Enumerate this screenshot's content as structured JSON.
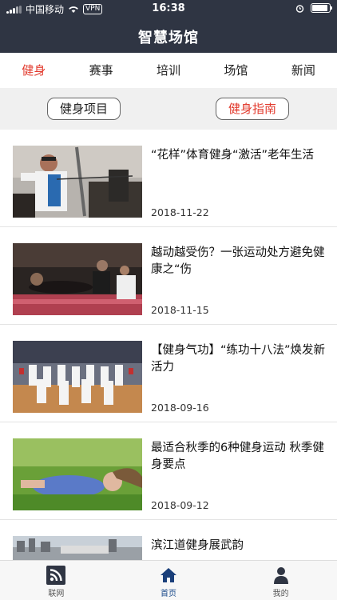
{
  "status_bar": {
    "carrier": "中国移动",
    "vpn": "VPN",
    "time": "16:38"
  },
  "header": {
    "title": "智慧场馆"
  },
  "tabs": [
    {
      "label": "健身",
      "active": true
    },
    {
      "label": "赛事",
      "active": false
    },
    {
      "label": "培训",
      "active": false
    },
    {
      "label": "场馆",
      "active": false
    },
    {
      "label": "新闻",
      "active": false
    }
  ],
  "sub_buttons": {
    "left": "健身项目",
    "right": "健身指南"
  },
  "articles": [
    {
      "title": "“花样”体育健身“激活”老年生活",
      "date": "2018-11-22",
      "image": "archery"
    },
    {
      "title": "越动越受伤？一张运动处方避免健康之“伤",
      "date": "2018-11-15",
      "image": "gym-plank"
    },
    {
      "title": "【健身气功】“练功十八法”焕发新活力",
      "date": "2018-09-16",
      "image": "qigong-group"
    },
    {
      "title": "最适合秋季的6种健身运动 秋季健身要点",
      "date": "2018-09-12",
      "image": "grass-lying"
    },
    {
      "title": "滨江道健身展武韵",
      "date": "",
      "image": "riverside"
    }
  ],
  "bottom_nav": [
    {
      "label": "联网",
      "icon": "rss-icon",
      "active": false
    },
    {
      "label": "首页",
      "icon": "home-icon",
      "active": true
    },
    {
      "label": "我的",
      "icon": "person-icon",
      "active": false
    }
  ],
  "colors": {
    "header_bg": "#2f3543",
    "accent_red": "#e23b2e",
    "active_nav": "#1a4a8a"
  }
}
